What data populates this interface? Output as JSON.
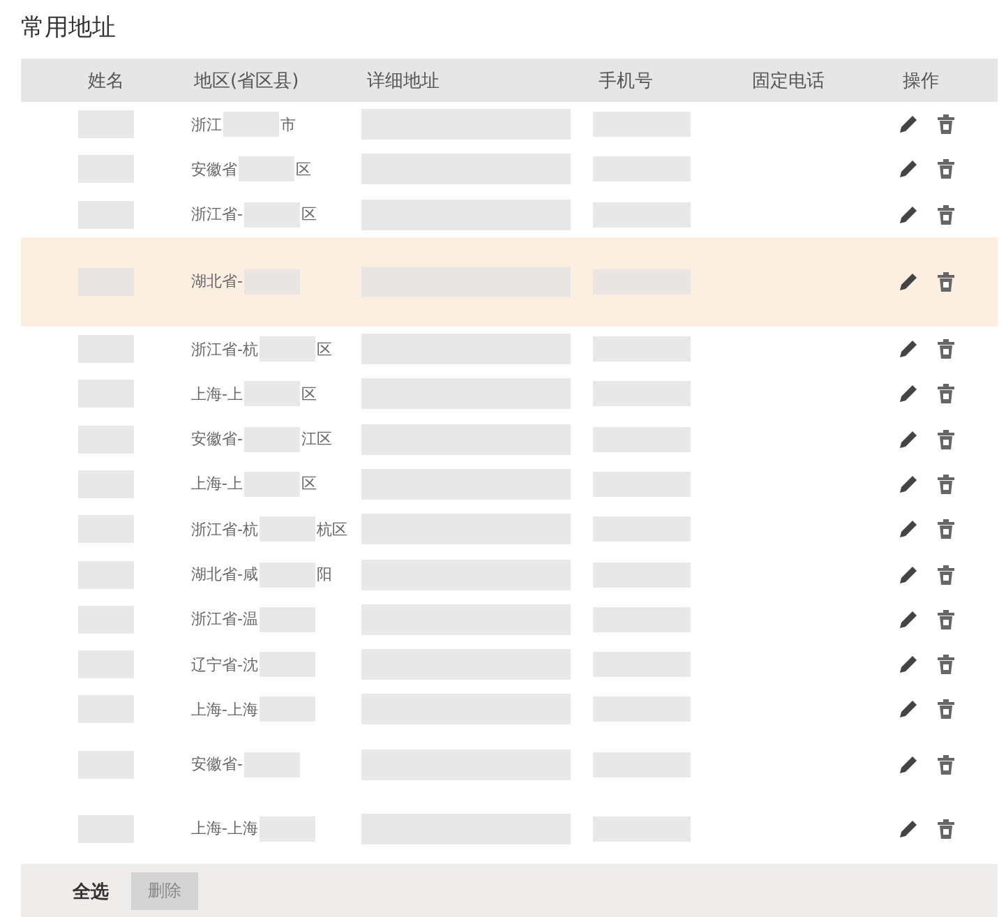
{
  "title": "常用地址",
  "table": {
    "columns": [
      "姓名",
      "地区(省区县)",
      "详细地址",
      "手机号",
      "固定电话",
      "操作"
    ],
    "rows": [
      {
        "region_start": "浙江",
        "region_end": "市",
        "tall": false,
        "selected": false
      },
      {
        "region_start": "安徽省",
        "region_end": "区",
        "tall": false,
        "selected": false
      },
      {
        "region_start": "浙江省-",
        "region_end": "区",
        "tall": false,
        "selected": false
      },
      {
        "region_start": "湖北省-",
        "region_end": "",
        "tall": true,
        "selected": true
      },
      {
        "region_start": "浙江省-杭",
        "region_end": "区",
        "tall": false,
        "selected": false
      },
      {
        "region_start": "上海-上",
        "region_end": "区",
        "tall": false,
        "selected": false
      },
      {
        "region_start": "安徽省-",
        "region_end": "江区",
        "tall": false,
        "selected": false
      },
      {
        "region_start": "上海-上",
        "region_end": "区",
        "tall": false,
        "selected": false
      },
      {
        "region_start": "浙江省-杭",
        "region_end": "杭区",
        "tall": false,
        "selected": false
      },
      {
        "region_start": "湖北省-咸",
        "region_end": "阳",
        "tall": false,
        "selected": false
      },
      {
        "region_start": "浙江省-温",
        "region_end": "",
        "tall": false,
        "selected": false
      },
      {
        "region_start": "辽宁省-沈",
        "region_end": "",
        "tall": false,
        "selected": false
      },
      {
        "region_start": "上海-上海",
        "region_end": "",
        "tall": false,
        "selected": false
      },
      {
        "region_start": "安徽省-",
        "region_end": "",
        "tall": true,
        "selected": false
      },
      {
        "region_start": "上海-上海",
        "region_end": "",
        "tall": true,
        "selected": false
      }
    ]
  },
  "footer": {
    "select_all": "全选",
    "delete_button": {
      "label": "删除",
      "disabled": true
    }
  }
}
